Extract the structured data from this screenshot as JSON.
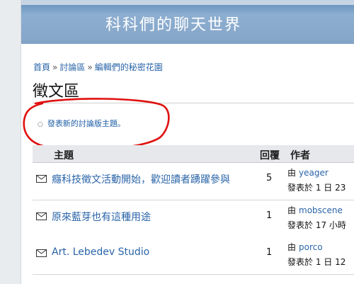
{
  "site": {
    "title": "科科們的聊天世界"
  },
  "breadcrumb": {
    "items": [
      "首頁",
      "討論區",
      "編輯們的秘密花園"
    ],
    "separator": "»"
  },
  "page": {
    "title": "徵文區"
  },
  "actions": {
    "new_topic": "發表新的討論版主題。"
  },
  "table": {
    "headers": {
      "topic": "主題",
      "replies": "回覆",
      "author": "作者"
    },
    "rows": [
      {
        "topic": "癮科技徵文活動開始，歡迎讀者踴躍參與",
        "replies": "5",
        "by": "由",
        "author": "yeager",
        "posted": "發表於 1 日 23"
      },
      {
        "topic": "原來藍芽也有這種用途",
        "replies": "1",
        "by": "由",
        "author": "mobscene",
        "posted": "發表於 17 小時"
      },
      {
        "topic": "Art. Lebedev Studio",
        "replies": "1",
        "by": "由",
        "author": "porco",
        "posted": "發表於 1 日 12"
      }
    ]
  },
  "colors": {
    "banner": "#86a7ca",
    "link": "#2a64a8",
    "annotation": "#e01010"
  },
  "icons": {
    "topic_icon": "envelope-icon",
    "bullet": "circle-bullet"
  }
}
